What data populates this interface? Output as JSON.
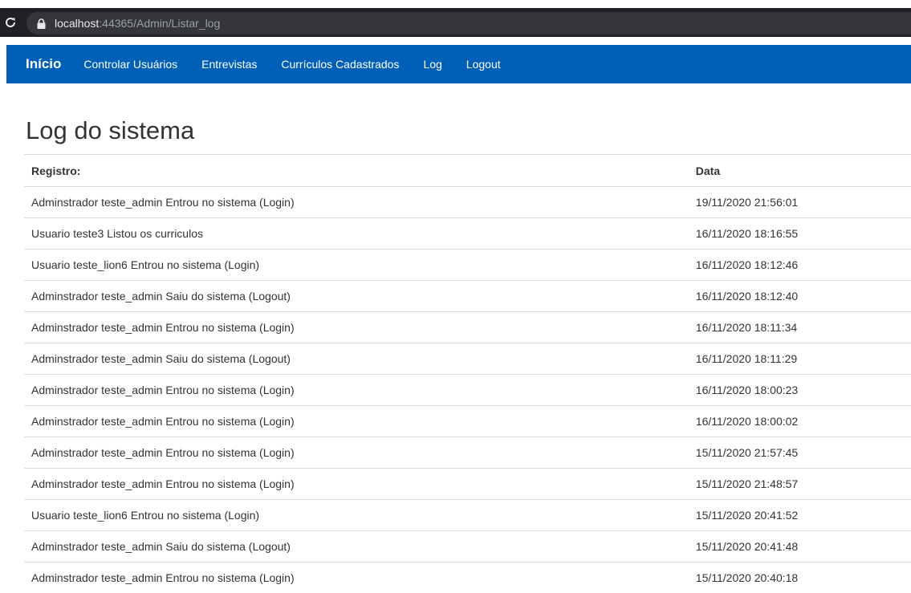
{
  "browser": {
    "url_host": "localhost",
    "url_rest": ":44365/Admin/Listar_log"
  },
  "navbar": {
    "brand": "Início",
    "links": [
      "Controlar Usuários",
      "Entrevistas",
      "Currículos Cadastrados",
      "Log",
      "Logout"
    ]
  },
  "page": {
    "title": "Log do sistema"
  },
  "table": {
    "headers": [
      "Registro:",
      "Data"
    ],
    "rows": [
      [
        "Adminstrador teste_admin Entrou no sistema (Login)",
        "19/11/2020 21:56:01"
      ],
      [
        "Usuario teste3 Listou os curriculos",
        "16/11/2020 18:16:55"
      ],
      [
        "Usuario teste_lion6 Entrou no sistema (Login)",
        "16/11/2020 18:12:46"
      ],
      [
        "Adminstrador teste_admin Saiu do sistema (Logout)",
        "16/11/2020 18:12:40"
      ],
      [
        "Adminstrador teste_admin Entrou no sistema (Login)",
        "16/11/2020 18:11:34"
      ],
      [
        "Adminstrador teste_admin Saiu do sistema (Logout)",
        "16/11/2020 18:11:29"
      ],
      [
        "Adminstrador teste_admin Entrou no sistema (Login)",
        "16/11/2020 18:00:23"
      ],
      [
        "Adminstrador teste_admin Entrou no sistema (Login)",
        "16/11/2020 18:00:02"
      ],
      [
        "Adminstrador teste_admin Entrou no sistema (Login)",
        "15/11/2020 21:57:45"
      ],
      [
        "Adminstrador teste_admin Entrou no sistema (Login)",
        "15/11/2020 21:48:57"
      ],
      [
        "Usuario teste_lion6 Entrou no sistema (Login)",
        "15/11/2020 20:41:52"
      ],
      [
        "Adminstrador teste_admin Saiu do sistema (Logout)",
        "15/11/2020 20:41:48"
      ],
      [
        "Adminstrador teste_admin Entrou no sistema (Login)",
        "15/11/2020 20:40:18"
      ]
    ]
  },
  "colors": {
    "navbar_bg": "#0060b8",
    "browser_dark": "#202124"
  }
}
